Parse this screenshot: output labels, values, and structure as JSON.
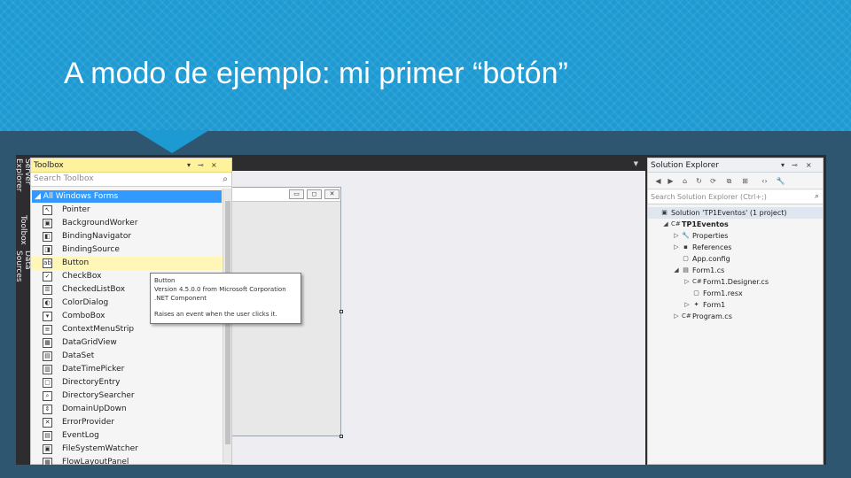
{
  "slide": {
    "title": "A modo de ejemplo: mi primer “botón”",
    "colors": {
      "header": "#1e9ad3",
      "background": "#2e5670"
    }
  },
  "side_tabs": [
    "Server Explorer",
    "Toolbox",
    "Data Sources"
  ],
  "toolbox": {
    "title": "Toolbox",
    "title_controls": [
      "▾",
      "⊸",
      "×"
    ],
    "search_placeholder": "Search Toolbox",
    "search_icon": "search-icon",
    "group": "◢ All Windows Forms",
    "selected_item": "Button",
    "items": [
      {
        "label": "Pointer",
        "icon": "pointer-icon",
        "glyph": "↖"
      },
      {
        "label": "BackgroundWorker",
        "icon": "background-worker-icon",
        "glyph": "▣"
      },
      {
        "label": "BindingNavigator",
        "icon": "binding-navigator-icon",
        "glyph": "◧"
      },
      {
        "label": "BindingSource",
        "icon": "binding-source-icon",
        "glyph": "◨"
      },
      {
        "label": "Button",
        "icon": "button-icon",
        "glyph": "ab"
      },
      {
        "label": "CheckBox",
        "icon": "checkbox-icon",
        "glyph": "✓"
      },
      {
        "label": "CheckedListBox",
        "icon": "checked-listbox-icon",
        "glyph": "☰"
      },
      {
        "label": "ColorDialog",
        "icon": "color-dialog-icon",
        "glyph": "◐"
      },
      {
        "label": "ComboBox",
        "icon": "combobox-icon",
        "glyph": "▾"
      },
      {
        "label": "ContextMenuStrip",
        "icon": "context-menu-icon",
        "glyph": "≡"
      },
      {
        "label": "DataGridView",
        "icon": "datagridview-icon",
        "glyph": "▦"
      },
      {
        "label": "DataSet",
        "icon": "dataset-icon",
        "glyph": "▤"
      },
      {
        "label": "DateTimePicker",
        "icon": "datetimepicker-icon",
        "glyph": "▥"
      },
      {
        "label": "DirectoryEntry",
        "icon": "directory-entry-icon",
        "glyph": "▢"
      },
      {
        "label": "DirectorySearcher",
        "icon": "directory-searcher-icon",
        "glyph": "⌕"
      },
      {
        "label": "DomainUpDown",
        "icon": "domain-updown-icon",
        "glyph": "⇕"
      },
      {
        "label": "ErrorProvider",
        "icon": "error-provider-icon",
        "glyph": "✕"
      },
      {
        "label": "EventLog",
        "icon": "eventlog-icon",
        "glyph": "▤"
      },
      {
        "label": "FileSystemWatcher",
        "icon": "filesystem-watcher-icon",
        "glyph": "▣"
      },
      {
        "label": "FlowLayoutPanel",
        "icon": "flowlayout-panel-icon",
        "glyph": "▦"
      }
    ]
  },
  "form_window": {
    "controls": [
      {
        "glyph": "▭",
        "icon": "minimize-icon"
      },
      {
        "glyph": "◻",
        "icon": "maximize-icon"
      },
      {
        "glyph": "✕",
        "icon": "close-icon"
      }
    ]
  },
  "tooltip": {
    "lines": [
      "Button",
      "Version 4.5.0.0 from Microsoft Corporation",
      ".NET Component",
      "Raises an event when the user clicks it."
    ]
  },
  "solution_explorer": {
    "title": "Solution Explorer",
    "title_controls": [
      "▾",
      "⊸",
      "×"
    ],
    "search_placeholder": "Search Solution Explorer (Ctrl+;)",
    "toolbar": [
      "◀",
      "▶",
      "⌂",
      "↻",
      "⟳",
      "⧉",
      "⊞",
      "‹›",
      "🔧"
    ],
    "tree": [
      {
        "label": "Solution 'TP1Eventos' (1 project)",
        "level": 0,
        "arrow": "",
        "glyph": "▣",
        "icon": "solution-icon",
        "bold": false,
        "selected": true
      },
      {
        "label": "TP1Eventos",
        "level": 1,
        "arrow": "◢",
        "glyph": "C#",
        "icon": "csharp-project-icon",
        "bold": true,
        "selected": false
      },
      {
        "label": "Properties",
        "level": 2,
        "arrow": "▷",
        "glyph": "🔧",
        "icon": "properties-icon",
        "bold": false,
        "selected": false
      },
      {
        "label": "References",
        "level": 2,
        "arrow": "▷",
        "glyph": "▪",
        "icon": "references-icon",
        "bold": false,
        "selected": false
      },
      {
        "label": "App.config",
        "level": 2,
        "arrow": "",
        "glyph": "▢",
        "icon": "config-icon",
        "bold": false,
        "selected": false
      },
      {
        "label": "Form1.cs",
        "level": 2,
        "arrow": "◢",
        "glyph": "▤",
        "icon": "form-icon",
        "bold": false,
        "selected": false
      },
      {
        "label": "Form1.Designer.cs",
        "level": 3,
        "arrow": "▷",
        "glyph": "C#",
        "icon": "csharp-file-icon",
        "bold": false,
        "selected": false
      },
      {
        "label": "Form1.resx",
        "level": 3,
        "arrow": "",
        "glyph": "▢",
        "icon": "resx-icon",
        "bold": false,
        "selected": false
      },
      {
        "label": "Form1",
        "level": 3,
        "arrow": "▷",
        "glyph": "✦",
        "icon": "class-icon",
        "bold": false,
        "selected": false
      },
      {
        "label": "Program.cs",
        "level": 2,
        "arrow": "▷",
        "glyph": "C#",
        "icon": "csharp-file-icon",
        "bold": false,
        "selected": false
      }
    ]
  }
}
